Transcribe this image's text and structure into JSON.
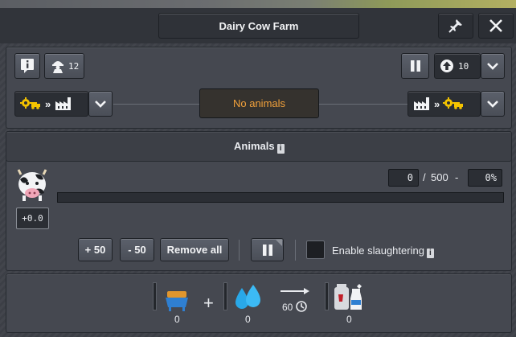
{
  "window": {
    "title": "Dairy Cow Farm"
  },
  "top": {
    "workers_count": "12",
    "upgrade_level": "10",
    "status": "No animals",
    "status_color": "#f2a13b"
  },
  "animals": {
    "title": "Animals",
    "count": "0",
    "separator": "/",
    "capacity": "500",
    "dash": "-",
    "percent": "0%",
    "fill_fraction": 0,
    "growth": "+0.0",
    "add_label": "+ 50",
    "remove_label": "- 50",
    "remove_all_label": "Remove all",
    "slaughter_label": "Enable slaughtering",
    "slaughter_enabled": false
  },
  "recipe": {
    "input1_amount": "0",
    "plus": "+",
    "input2_amount": "0",
    "duration": "60",
    "output_amount": "0"
  },
  "colors": {
    "panel": "#454850",
    "accent_orange": "#f2a13b",
    "gear_yellow": "#f5c400",
    "water_blue": "#29a8e8"
  }
}
